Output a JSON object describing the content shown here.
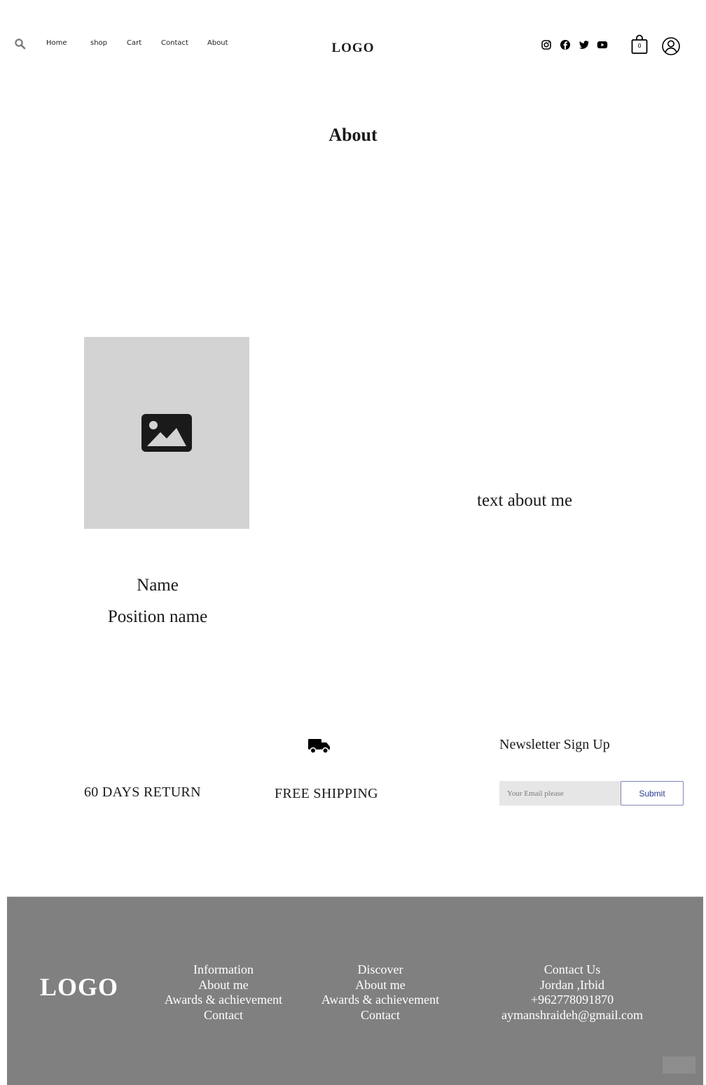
{
  "header": {
    "logo": "LOGO",
    "nav": [
      "Home",
      "shop",
      "Cart",
      "Contact",
      "About"
    ],
    "cart_count": "0",
    "social_icons": [
      "instagram-icon",
      "facebook-icon",
      "twitter-icon",
      "youtube-icon"
    ]
  },
  "page": {
    "title": "About",
    "name": "Name",
    "position": "Position name",
    "about_text": "text about me"
  },
  "features": {
    "return_label": "60 DAYS RETURN",
    "shipping_label": "FREE SHIPPING",
    "newsletter_title": "Newsletter Sign Up",
    "email_placeholder": "Your Email please",
    "submit_label": "Submit"
  },
  "footer": {
    "logo": "LOGO",
    "information": {
      "title": "Information",
      "links": [
        "About me",
        "Awards & achievement",
        "Contact"
      ]
    },
    "discover": {
      "title": "Discover",
      "links": [
        "About me",
        "Awards & achievement",
        "Contact"
      ]
    },
    "contact": {
      "title": "Contact Us",
      "location": "Jordan ,Irbid",
      "phone": "+962778091870",
      "email": "aymanshraideh@gmail.com"
    }
  },
  "colors": {
    "footer_bg": "#808080",
    "placeholder_bg": "#d3d3d3",
    "submit_text": "#2a3b8f"
  }
}
